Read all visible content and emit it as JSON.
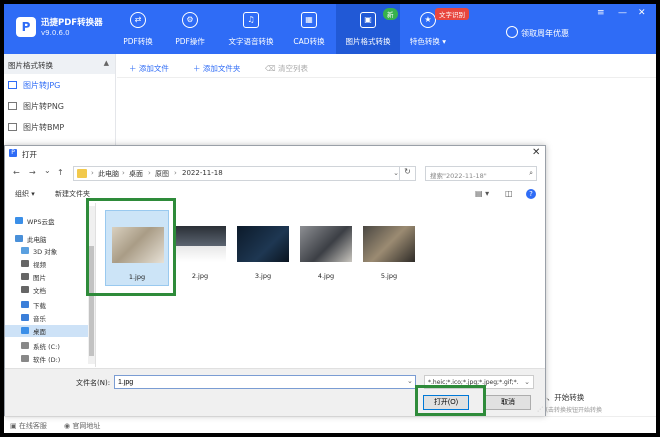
{
  "app": {
    "title": "迅捷PDF转换器",
    "version": "v9.0.6.0",
    "logo_letter": "P",
    "brand_color": "#2f6cf6",
    "active_nav_color": "#2159d6"
  },
  "nav": [
    {
      "label": "PDF转换",
      "icon": "pdf-convert-icon",
      "glyph": "⇄"
    },
    {
      "label": "PDF操作",
      "icon": "pdf-ops-icon",
      "glyph": "⚙"
    },
    {
      "label": "文字语音转换",
      "icon": "text-voice-icon",
      "glyph": "♫"
    },
    {
      "label": "CAD转换",
      "icon": "cad-icon",
      "glyph": "▦"
    },
    {
      "label": "图片格式转换",
      "icon": "image-format-icon",
      "glyph": "▣",
      "active": true
    },
    {
      "label": "特色转换 ▾",
      "icon": "feature-icon",
      "glyph": "★"
    }
  ],
  "badges": {
    "new": "新",
    "promo": "文字识别"
  },
  "window_controls": [
    "≡",
    "—",
    "✕"
  ],
  "user": {
    "label": "领取周年优惠"
  },
  "sidebar": {
    "header": "图片格式转换",
    "collapse_glyph": "▲",
    "items": [
      {
        "label": "图片转JPG",
        "active": true
      },
      {
        "label": "图片转PNG"
      },
      {
        "label": "图片转BMP"
      }
    ]
  },
  "toolbar": {
    "add_file": "添加文件",
    "add_folder": "添加文件夹",
    "clear_list": "清空列表"
  },
  "main_hint": {
    "step": "3、开始转换",
    "sub": "点击转换按钮开始转换"
  },
  "status_bar": {
    "online_service": "在线客服",
    "website": "官网地址"
  },
  "dialog": {
    "title": "打开",
    "close": "✕",
    "nav": {
      "back": "←",
      "forward": "→",
      "recent": "⌄",
      "up": "↑"
    },
    "breadcrumbs": [
      "此电脑",
      "桌面",
      "原图",
      "2022-11-18"
    ],
    "breadcrumb_sep": "›",
    "refresh": "↻",
    "search_placeholder": "搜索\"2022-11-18\"",
    "search_icon": "⌕",
    "organize": "组织 ▾",
    "new_folder": "新建文件夹",
    "view_icon": "▤ ▾",
    "pane_icon": "◫",
    "help": "?",
    "tree": [
      {
        "label": "WPS云盘",
        "icon": "cloud-icon",
        "color": "#3b8fe8"
      },
      {
        "label": "此电脑",
        "icon": "computer-icon",
        "color": "#4a90d9"
      },
      {
        "label": "3D 对象",
        "icon": "3d-icon",
        "color": "#5aa0e0"
      },
      {
        "label": "视频",
        "icon": "video-icon",
        "color": "#666"
      },
      {
        "label": "图片",
        "icon": "pictures-icon",
        "color": "#666"
      },
      {
        "label": "文档",
        "icon": "documents-icon",
        "color": "#666"
      },
      {
        "label": "下载",
        "icon": "download-icon",
        "color": "#3b7fd9"
      },
      {
        "label": "音乐",
        "icon": "music-icon",
        "color": "#3b7fd9"
      },
      {
        "label": "桌面",
        "icon": "desktop-icon",
        "color": "#3b8fe8",
        "selected": true
      },
      {
        "label": "系统 (C:)",
        "icon": "drive-c-icon",
        "color": "#888"
      },
      {
        "label": "软件 (D:)",
        "icon": "drive-d-icon",
        "color": "#888"
      }
    ],
    "files": [
      {
        "name": "1.jpg",
        "selected": true,
        "bg": "linear-gradient(135deg,#d9d0bf,#a99c86 45%,#e7e1d6)"
      },
      {
        "name": "2.jpg",
        "bg": "linear-gradient(180deg,#2a2f36 0%,#5b6470 55%,#e8e8e8 56%,#ffffff 100%)"
      },
      {
        "name": "3.jpg",
        "bg": "linear-gradient(135deg,#0c1a2a,#1e3752 60%,#0a141f)"
      },
      {
        "name": "4.jpg",
        "bg": "linear-gradient(135deg,#8d8f93,#3c3f45 55%,#c9c6bf)"
      },
      {
        "name": "5.jpg",
        "bg": "linear-gradient(135deg,#4a4742,#9b8b72 50%,#2e2b27)"
      }
    ],
    "filename_label": "文件名(N):",
    "filename_value": "1.jpg",
    "filter_value": "*.heic;*.ico;*.jpg;*.jpeg;*.gif;*.",
    "open_button": "打开(O)",
    "cancel_button": "取消",
    "highlight_color": "#2e8b3a"
  }
}
